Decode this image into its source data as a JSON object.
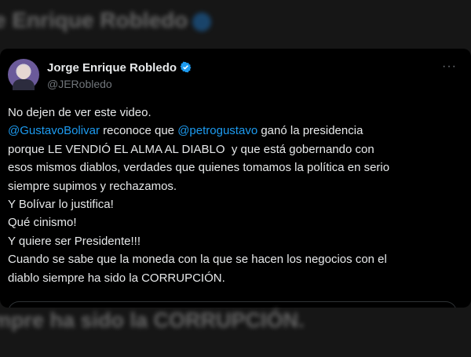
{
  "background_blur": {
    "top_text": "e Enrique Robledo",
    "bottom_text": "mpre ha sido la CORRUPCIÓN."
  },
  "tweet": {
    "author_name": "Jorge Enrique Robledo",
    "handle": "@JERobledo",
    "more_label": "···",
    "verified_color": "#1d9bf0",
    "mention_color": "#1d9bf0",
    "lines": {
      "l1": "No dejen de ver este video.",
      "l2_mention1": "@GustavoBolivar",
      "l2_mid": " reconoce que ",
      "l2_mention2": "@petrogustavo",
      "l2_end": " ganó la presidencia",
      "l3": "porque LE VENDIÓ EL ALMA AL DIABLO  y que está gobernando con",
      "l4": "esos mismos diablos, verdades que quienes tomamos la política en serio",
      "l5": "siempre supimos y rechazamos.",
      "l6": "Y Bolívar lo justifica!",
      "l7": "Qué cinismo!",
      "l8": "Y quiere ser Presidente!!!",
      "l9": "Cuando se sabe que la moneda con la que se hacen los negocios con el",
      "l10": "diablo siempre ha sido la CORRUPCIÓN."
    }
  }
}
